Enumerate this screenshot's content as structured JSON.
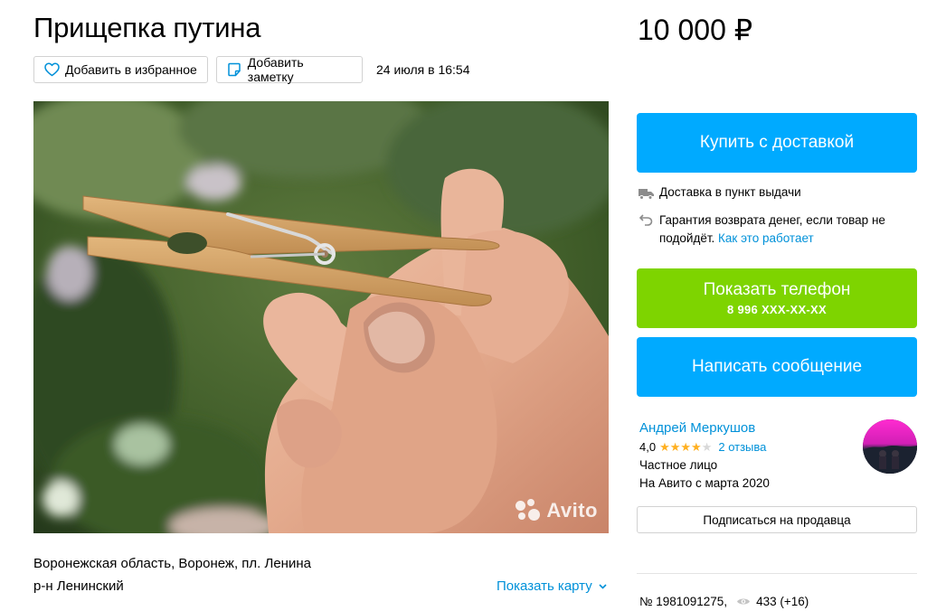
{
  "listing": {
    "title": "Прищепка путина",
    "price": "10 000 ₽",
    "posted_date": "24 июля в 16:54",
    "photo_watermark": "Avito"
  },
  "actions": {
    "favorite_label": "Добавить в избранное",
    "note_label": "Добавить заметку",
    "favorite_icon": "heart-icon",
    "note_icon": "note-icon"
  },
  "location": {
    "address": "Воронежская область, Воронеж, пл. Ленина",
    "district": "р-н Ленинский",
    "show_map_label": "Показать карту"
  },
  "purchase": {
    "buy_label": "Купить с доставкой",
    "delivery_text": "Доставка в пункт выдачи",
    "guarantee_text": "Гарантия возврата денег, если товар не подойдёт.",
    "guarantee_link": "Как это работает",
    "phone_label": "Показать телефон",
    "phone_masked": "8 996 XXX-XX-XX",
    "message_label": "Написать сообщение"
  },
  "seller": {
    "name": "Андрей Меркушов",
    "rating": "4,0",
    "rating_stars": 4,
    "rating_max": 5,
    "reviews": "2 отзыва",
    "type": "Частное лицо",
    "since": "На Авито с марта 2020",
    "subscribe_label": "Подписаться на продавца"
  },
  "stats": {
    "ad_number": "№ 1981091275,",
    "views": "433 (+16)"
  },
  "colors": {
    "primary_blue": "#00aaff",
    "phone_green": "#7ed400",
    "link_blue": "#0091d9",
    "star": "#ffb021"
  }
}
